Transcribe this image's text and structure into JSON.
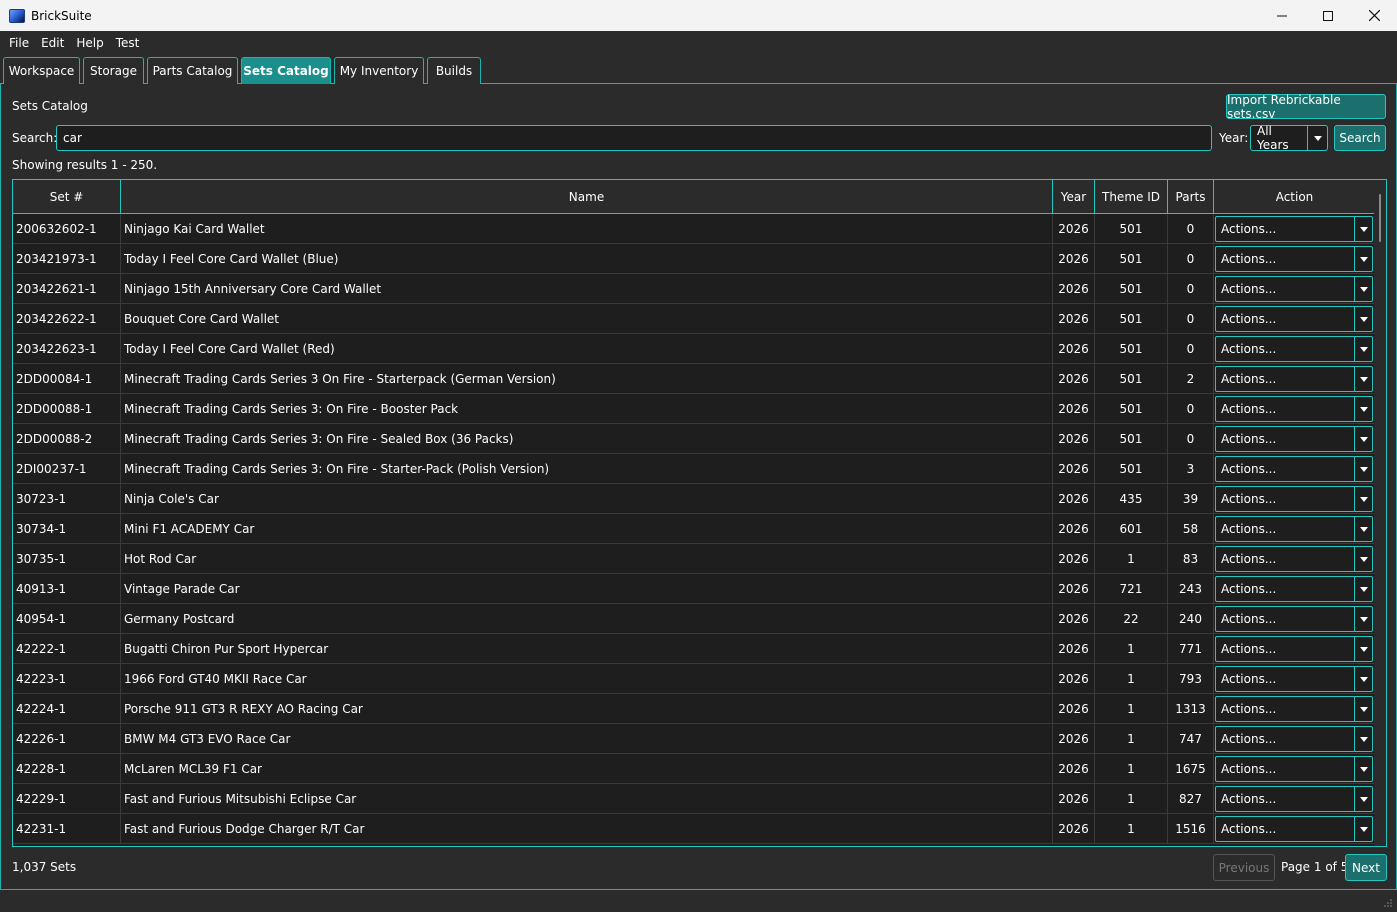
{
  "window": {
    "title": "BrickSuite"
  },
  "menu": [
    "File",
    "Edit",
    "Help",
    "Test"
  ],
  "tabs": [
    "Workspace",
    "Storage",
    "Parts Catalog",
    "Sets Catalog",
    "My Inventory",
    "Builds"
  ],
  "active_tab": "Sets Catalog",
  "section": {
    "title": "Sets Catalog",
    "import_button": "Import Rebrickable sets.csv"
  },
  "search": {
    "label": "Search:",
    "value": "car",
    "year_label": "Year:",
    "year_value": "All Years",
    "button": "Search"
  },
  "results_text": "Showing results 1 - 250.",
  "table": {
    "columns": [
      "Set #",
      "Name",
      "Year",
      "Theme ID",
      "Parts",
      "Action"
    ],
    "action_label": "Actions...",
    "rows": [
      [
        "200632602-1",
        "Ninjago Kai Card Wallet",
        "2026",
        "501",
        "0"
      ],
      [
        "203421973-1",
        "Today I Feel Core Card Wallet (Blue)",
        "2026",
        "501",
        "0"
      ],
      [
        "203422621-1",
        "Ninjago 15th Anniversary Core Card Wallet",
        "2026",
        "501",
        "0"
      ],
      [
        "203422622-1",
        "Bouquet Core Card Wallet",
        "2026",
        "501",
        "0"
      ],
      [
        "203422623-1",
        "Today I Feel Core Card Wallet (Red)",
        "2026",
        "501",
        "0"
      ],
      [
        "2DD00084-1",
        "Minecraft Trading Cards Series 3 On Fire - Starterpack (German Version)",
        "2026",
        "501",
        "2"
      ],
      [
        "2DD00088-1",
        "Minecraft Trading Cards Series 3: On Fire - Booster Pack",
        "2026",
        "501",
        "0"
      ],
      [
        "2DD00088-2",
        "Minecraft Trading Cards Series 3: On Fire - Sealed Box (36 Packs)",
        "2026",
        "501",
        "0"
      ],
      [
        "2DI00237-1",
        "Minecraft Trading Cards Series 3: On Fire - Starter-Pack (Polish Version)",
        "2026",
        "501",
        "3"
      ],
      [
        "30723-1",
        "Ninja Cole's Car",
        "2026",
        "435",
        "39"
      ],
      [
        "30734-1",
        "Mini F1 ACADEMY Car",
        "2026",
        "601",
        "58"
      ],
      [
        "30735-1",
        "Hot Rod Car",
        "2026",
        "1",
        "83"
      ],
      [
        "40913-1",
        "Vintage Parade Car",
        "2026",
        "721",
        "243"
      ],
      [
        "40954-1",
        "Germany Postcard",
        "2026",
        "22",
        "240"
      ],
      [
        "42222-1",
        "Bugatti Chiron Pur Sport Hypercar",
        "2026",
        "1",
        "771"
      ],
      [
        "42223-1",
        "1966 Ford GT40 MKII Race Car",
        "2026",
        "1",
        "793"
      ],
      [
        "42224-1",
        "Porsche 911 GT3 R REXY AO Racing Car",
        "2026",
        "1",
        "1313"
      ],
      [
        "42226-1",
        "BMW M4 GT3 EVO Race Car",
        "2026",
        "1",
        "747"
      ],
      [
        "42228-1",
        "McLaren MCL39 F1 Car",
        "2026",
        "1",
        "1675"
      ],
      [
        "42229-1",
        "Fast and Furious Mitsubishi Eclipse Car",
        "2026",
        "1",
        "827"
      ],
      [
        "42231-1",
        "Fast and Furious Dodge Charger R/T Car",
        "2026",
        "1",
        "1516"
      ]
    ]
  },
  "footer": {
    "count": "1,037 Sets",
    "previous": "Previous",
    "page": "Page 1 of 5",
    "next": "Next"
  },
  "colors": {
    "accent": "#26c6c0",
    "active_tab": "#1b8f8b",
    "background": "#2b2b2b",
    "table_bg": "#1e1e1e"
  },
  "icons": {
    "minimize": "minimize-icon",
    "maximize": "maximize-icon",
    "close": "close-icon",
    "dropdown": "chevron-down-icon"
  }
}
